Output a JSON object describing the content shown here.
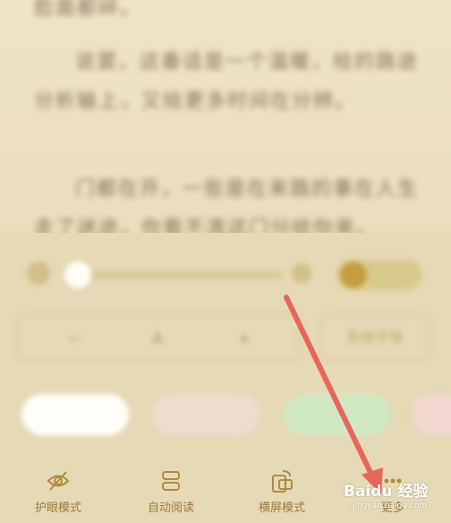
{
  "reader": {
    "paragraphs": [
      "脸面都碎。",
      "说罢，这番话是一个温暖，给的路途分析输上，又给更多时间在分辨。",
      "门都在开，一些是在来路的事在人生走了迷途，你看不清这门分给你来。"
    ]
  },
  "settings": {
    "font_size_value": "A",
    "font_type_label": "系统字体"
  },
  "toolbar": {
    "items": [
      {
        "label": "护眼模式",
        "icon": "eye-off-icon"
      },
      {
        "label": "自动阅读",
        "icon": "auto-read-icon"
      },
      {
        "label": "横屏模式",
        "icon": "rotate-screen-icon"
      },
      {
        "label": "更多",
        "icon": "more-icon"
      }
    ]
  },
  "watermark": {
    "logo_text": "Baidu 经验",
    "url_text": "jingyan.baidu.com"
  },
  "colors": {
    "background": "#ece1c3",
    "accent": "#c49d3e",
    "arrow": "#e8655a"
  }
}
